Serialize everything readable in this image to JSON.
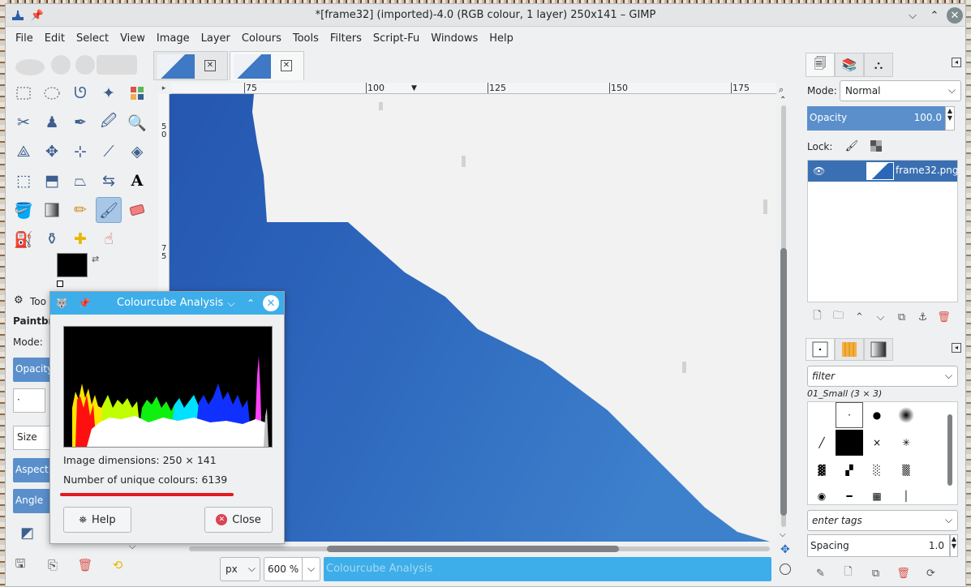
{
  "window": {
    "title": "*[frame32] (imported)-4.0 (RGB colour, 1 layer) 250x141 – GIMP"
  },
  "menu": [
    "File",
    "Edit",
    "Select",
    "View",
    "Image",
    "Layer",
    "Colours",
    "Tools",
    "Filters",
    "Script-Fu",
    "Windows",
    "Help"
  ],
  "ruler": {
    "top_ticks": [
      "75",
      "100",
      "125",
      "150",
      "175"
    ],
    "left_ticks": [
      "5",
      "0",
      "7",
      "5"
    ]
  },
  "tool_options": {
    "tab_label": "Too",
    "paint_label": "Paintbr",
    "mode_label": "Mode:",
    "opacity_label": "Opacity",
    "size_label": "Size",
    "aspect_label": "Aspect",
    "angle_label": "Angle"
  },
  "statusbar": {
    "unit": "px",
    "zoom": "600 %",
    "message": "Colourcube Analysis"
  },
  "layers": {
    "mode_label": "Mode:",
    "mode_value": "Normal",
    "opacity_label": "Opacity",
    "opacity_value": "100.0",
    "lock_label": "Lock:",
    "layer_name": "frame32.png"
  },
  "brushes": {
    "filter_placeholder": "filter",
    "brush_name": "01_Small (3 × 3)",
    "tags_placeholder": "enter tags",
    "spacing_label": "Spacing",
    "spacing_value": "1.0"
  },
  "dialog": {
    "title": "Colourcube Analysis",
    "dimensions": "Image dimensions: 250 × 141",
    "unique_colours": "Number of unique colours: 6139",
    "help_label": "Help",
    "close_label": "Close",
    "highlight_color": "#e3191e"
  },
  "colors": {
    "accent": "#3daee9",
    "selected": "#5a8fcc",
    "canvas_blue": "#2b67b8"
  }
}
